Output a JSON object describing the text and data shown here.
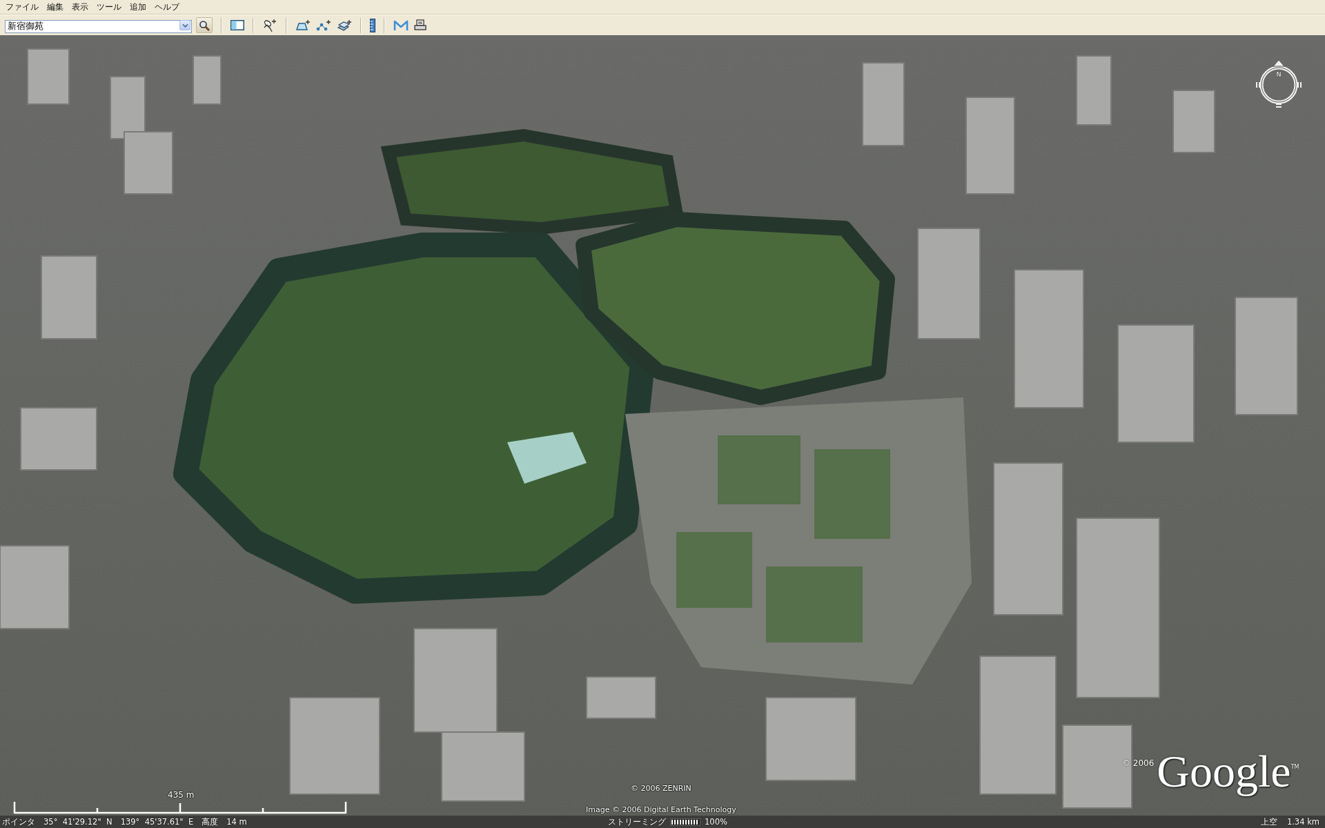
{
  "menu_bar": {
    "items": [
      "ファイル",
      "編集",
      "表示",
      "ツール",
      "追加",
      "ヘルプ"
    ]
  },
  "toolbar": {
    "search": {
      "value": "新宿御苑"
    }
  },
  "map_view": {
    "compass": {
      "north_label": "N"
    },
    "scale_bar": {
      "label": "435 m"
    },
    "attributions": [
      "© 2006 ZENRIN",
      "Image © 2006 Digital Earth Technology"
    ],
    "logo": {
      "copyright": "© 2006",
      "wordmark": "Google",
      "trademark": "TM"
    }
  },
  "status_bar": {
    "pointer_label": "ポインタ",
    "latitude": "35°  41'29.12\"  N",
    "longitude": "139°  45'37.61\"  E",
    "elevation_label": "高度",
    "elevation": "14 m",
    "streaming_label": "ストリーミング",
    "streaming": {
      "level": 1
    },
    "streaming_percent": "100%",
    "eye_altitude_label": "上空",
    "eye_altitude": "1.34 km"
  }
}
